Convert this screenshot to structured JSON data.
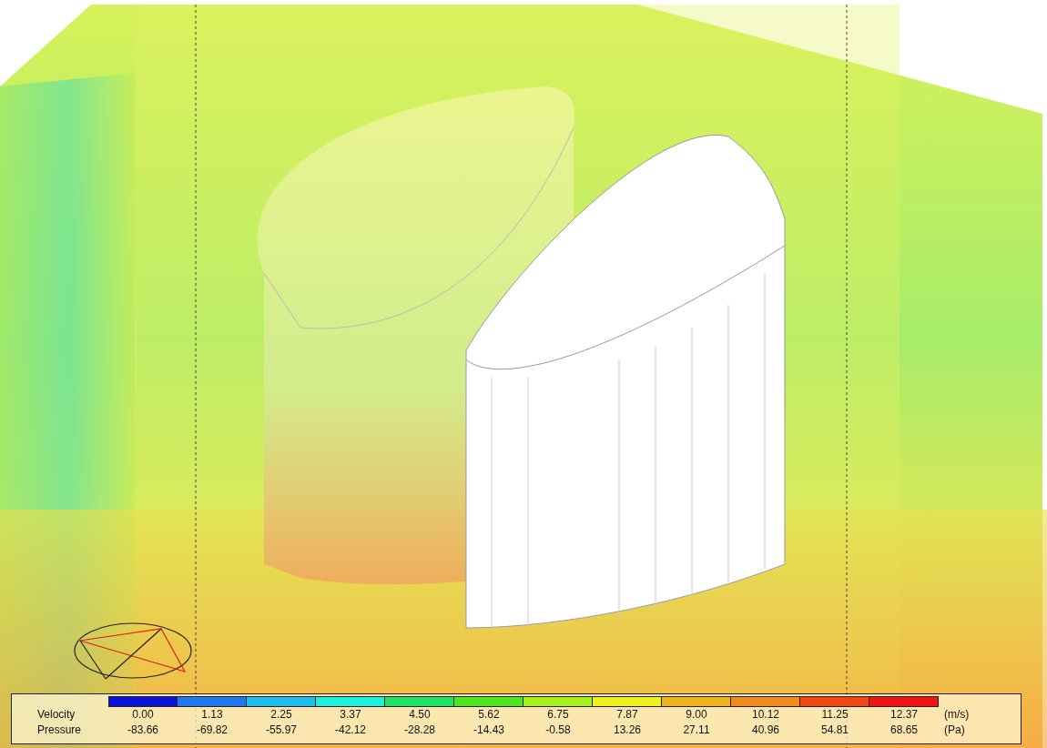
{
  "legend": {
    "swatches": [
      {
        "color": "#0a14d8"
      },
      {
        "color": "#1e78f0"
      },
      {
        "color": "#1ebef0"
      },
      {
        "color": "#1ef0dc"
      },
      {
        "color": "#1ee664"
      },
      {
        "color": "#4ee61e"
      },
      {
        "color": "#a6f01e"
      },
      {
        "color": "#f0f01e"
      },
      {
        "color": "#f0b41e"
      },
      {
        "color": "#f08c1e"
      },
      {
        "color": "#f04614"
      },
      {
        "color": "#f01414"
      }
    ],
    "rows": [
      {
        "label": "Velocity",
        "unit": "(m/s)",
        "values": [
          "0.00",
          "1.13",
          "2.25",
          "3.37",
          "4.50",
          "5.62",
          "6.75",
          "7.87",
          "9.00",
          "10.12",
          "11.25",
          "12.37"
        ]
      },
      {
        "label": "Pressure",
        "unit": "(Pa)",
        "values": [
          "-83.66",
          "-69.82",
          "-55.97",
          "-42.12",
          "-28.28",
          "-14.43",
          "-0.58",
          "13.26",
          "27.11",
          "40.96",
          "54.81",
          "68.65"
        ]
      }
    ]
  }
}
